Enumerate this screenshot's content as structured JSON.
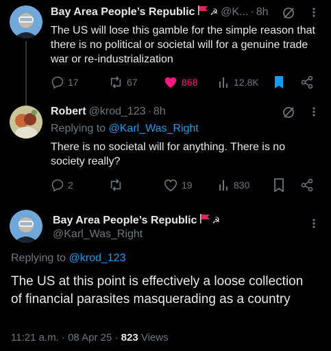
{
  "tweet1": {
    "name": "Bay Area People’s Republic",
    "handle": "@K...",
    "time": "8h",
    "text": "The US will lose this gamble for the simple reason that there is no political or societal will for a genuine trade war or re-industrialization",
    "replies": "17",
    "reposts": "67",
    "likes": "868",
    "views": "12.8K"
  },
  "tweet2": {
    "name": "Robert",
    "handle": "@krod_123",
    "time": "8h",
    "replying_prefix": "Replying to ",
    "replying_to": "@Karl_Was_Right",
    "text": "There is no societal will for anything. There is no society really?",
    "replies": "2",
    "likes": "19",
    "views": "830"
  },
  "tweet3": {
    "name": "Bay Area People’s Republic",
    "handle": "@Karl_Was_Right",
    "replying_prefix": "Replying to ",
    "replying_to": "@krod_123",
    "text": "The US at this point is effectively a loose collection of financial parasites masquerading as a country",
    "timestamp": "11:21 a.m. · 08 Apr 25 · ",
    "views_count": "823",
    "views_label": " Views"
  },
  "colors": {
    "background": "#000000",
    "text": "#e7e9ea",
    "muted": "#71767b",
    "link": "#1d9bf0",
    "like": "#f91880"
  }
}
